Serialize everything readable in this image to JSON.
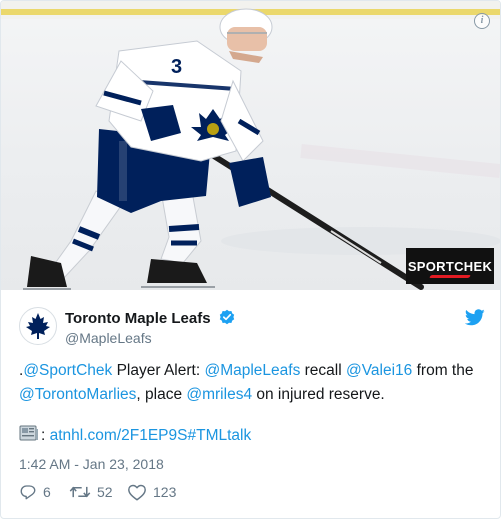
{
  "media": {
    "jersey_number": "3",
    "sponsor_label": "SPORTCHEK"
  },
  "author": {
    "display_name": "Toronto Maple Leafs",
    "handle": "@MapleLeafs"
  },
  "tweet": {
    "p1": ".",
    "m1": "@SportChek",
    "p2": " Player Alert: ",
    "m2": "@MapleLeafs",
    "p3": " recall ",
    "m3": "@Valei16",
    "p4": " from the ",
    "m4": "@TorontoMarlies",
    "p5": ", place ",
    "m5": "@mriles4",
    "p6": " on injured reserve.",
    "link_prefix": ": ",
    "link": "atnhl.com/2F1EP9S",
    "hashtag": "#TMLtalk"
  },
  "timestamp": "1:42 AM - Jan 23, 2018",
  "actions": {
    "replies": "6",
    "retweets": "52",
    "likes": "123"
  },
  "colors": {
    "link": "#1b95e0",
    "muted": "#657786",
    "leafs_blue": "#00205b",
    "sponsor_red": "#e31b23"
  },
  "icons": [
    "info-icon",
    "verified-badge-icon",
    "twitter-bird-icon",
    "newspaper-emoji-icon",
    "reply-icon",
    "retweet-icon",
    "like-icon"
  ]
}
